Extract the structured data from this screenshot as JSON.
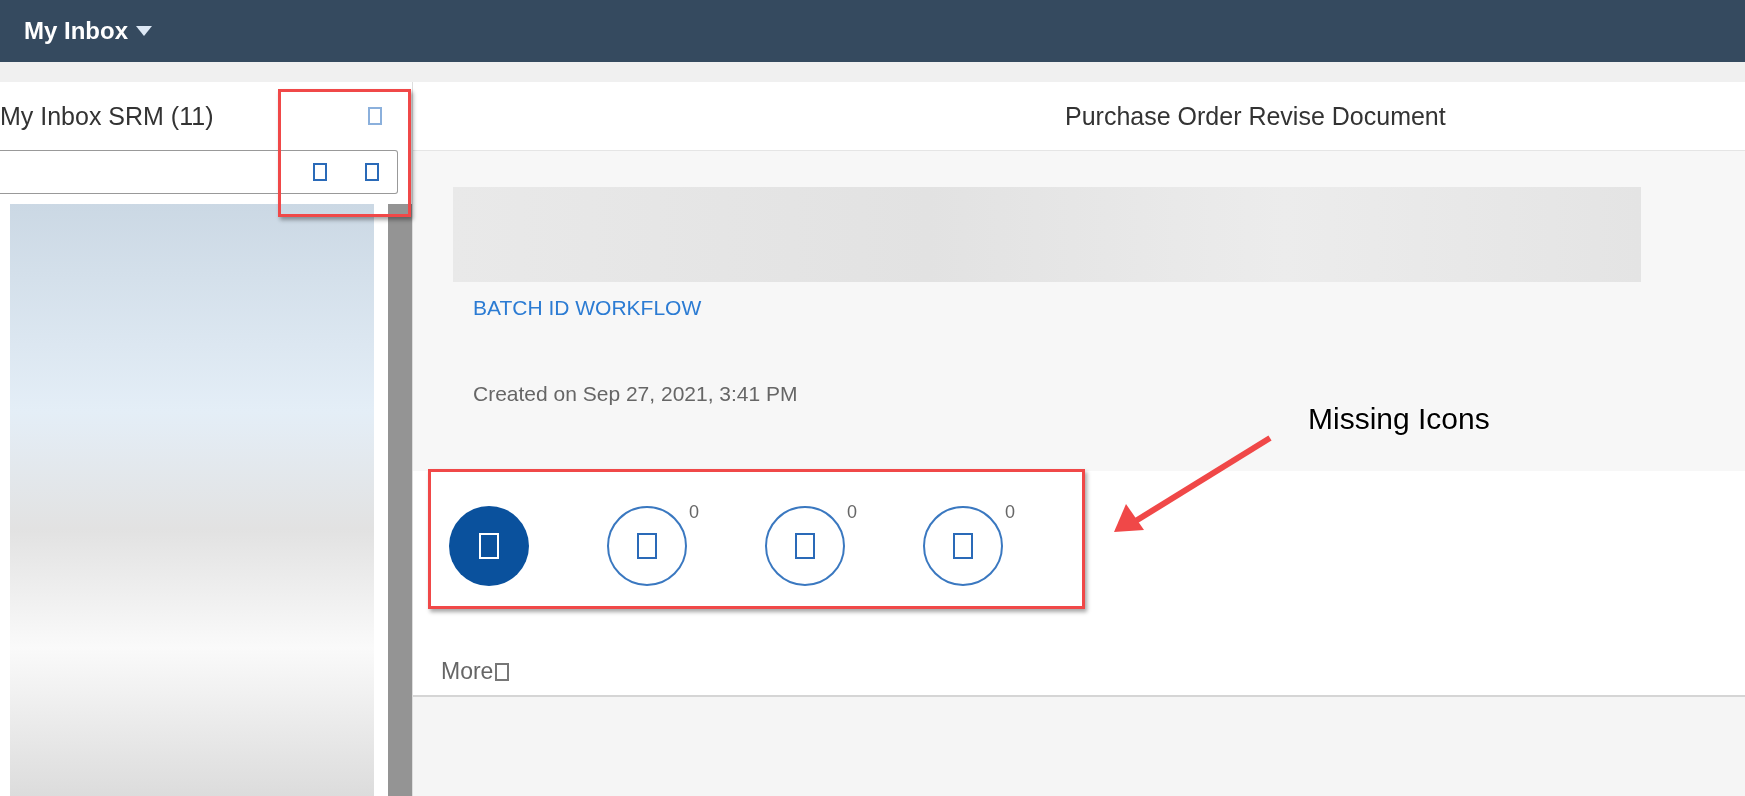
{
  "shell": {
    "title": "My Inbox"
  },
  "master": {
    "title": "My Inbox SRM (11)"
  },
  "detail": {
    "title": "Purchase Order Revise Document",
    "link": "BATCH ID WORKFLOW",
    "created": "Created on Sep 27, 2021, 3:41 PM",
    "icon_tabs": [
      {
        "selected": true
      },
      {
        "selected": false,
        "count": "0"
      },
      {
        "selected": false,
        "count": "0"
      },
      {
        "selected": false,
        "count": "0"
      }
    ],
    "more": "More"
  },
  "annotation": {
    "label": "Missing Icons"
  }
}
